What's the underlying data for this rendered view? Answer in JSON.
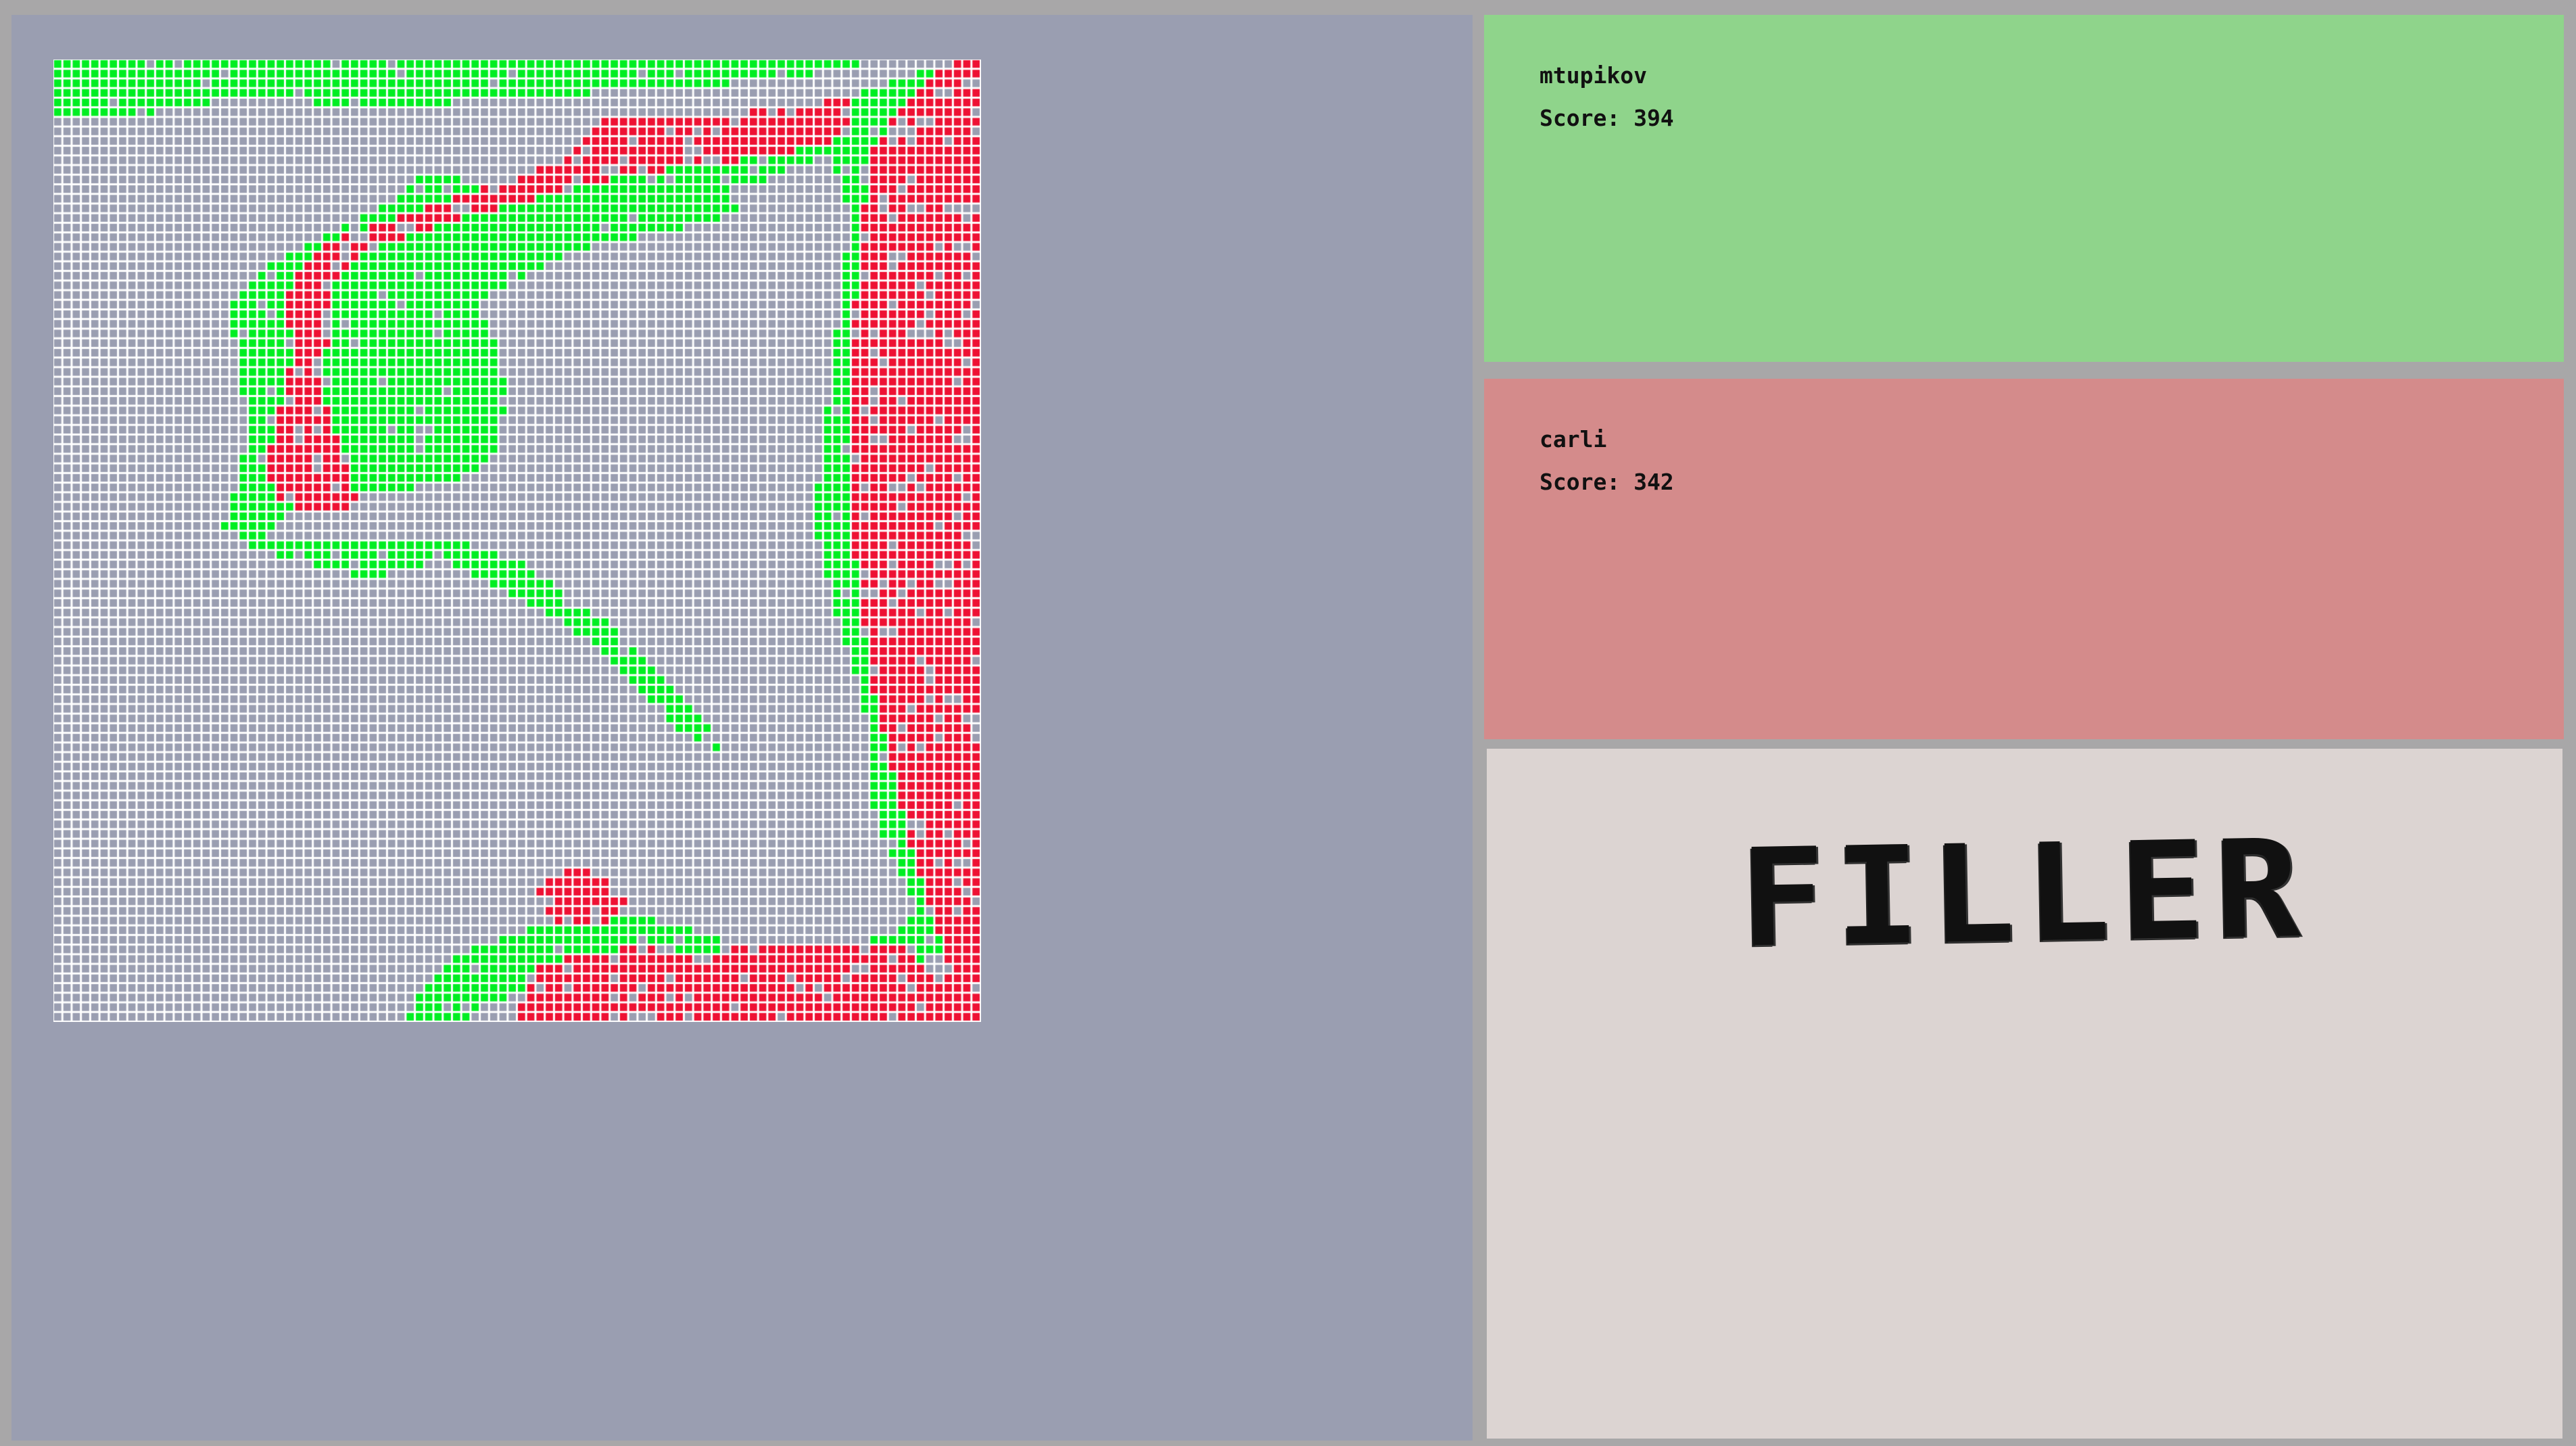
{
  "game": {
    "title": "FILLER",
    "board": {
      "cols": 100,
      "rows": 100,
      "colors": {
        "empty": "#9a9eb1",
        "grid_line": "#ffffff",
        "player1": "#00ee22",
        "player2": "#ee1133"
      }
    },
    "players": [
      {
        "name": "mtupikov",
        "score_text": "Score: 394",
        "color": "#8fd48b"
      },
      {
        "name": "carli",
        "score_text": "Score: 342",
        "color": "#d48b8b"
      }
    ]
  }
}
